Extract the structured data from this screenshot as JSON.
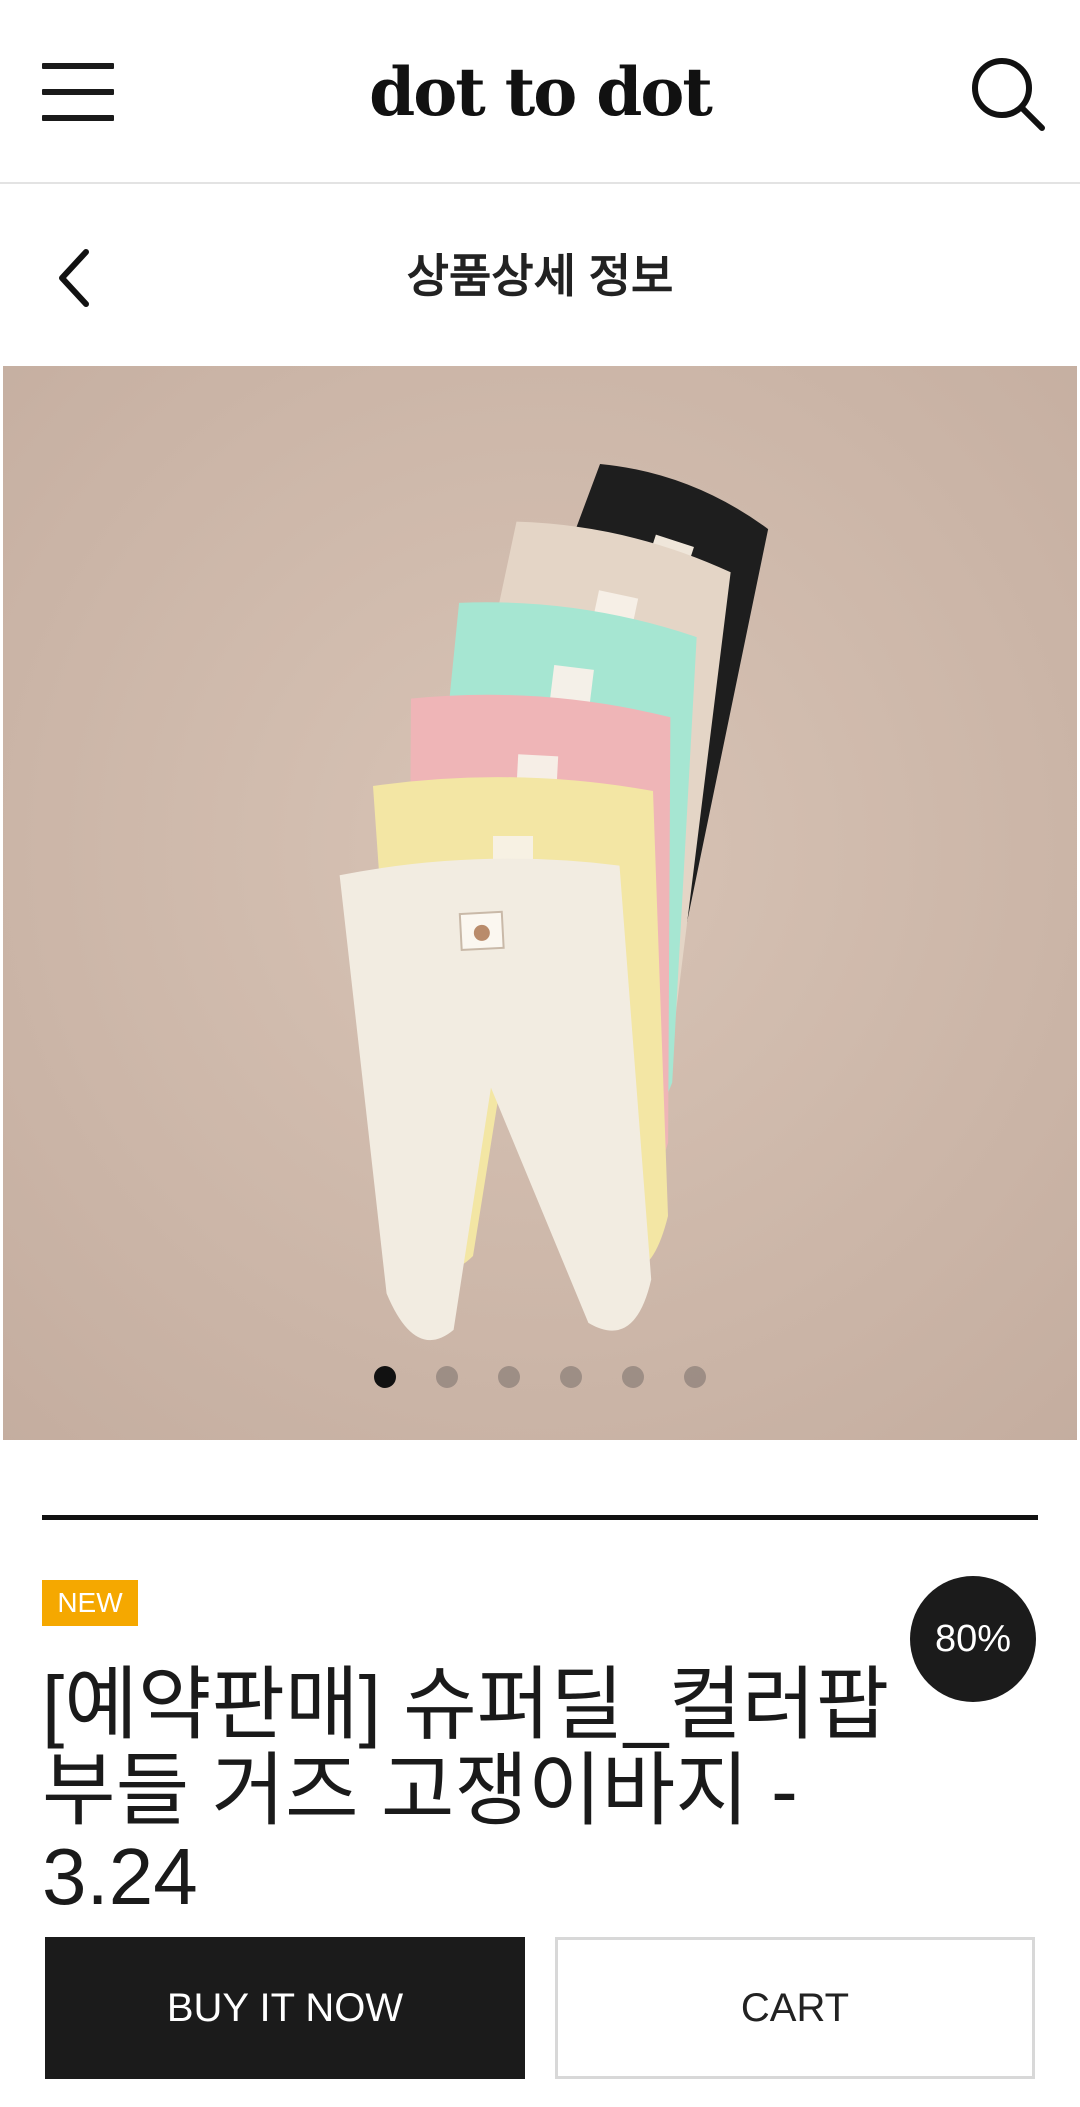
{
  "header": {
    "brand": "dot to dot",
    "menu_icon": "hamburger-menu-icon",
    "search_icon": "search-icon"
  },
  "subheader": {
    "back_icon": "chevron-left-icon",
    "title": "상품상세 정보"
  },
  "carousel": {
    "slide_count": 6,
    "active_index": 0,
    "image_description_icon": "product-photo"
  },
  "product": {
    "badge_new": "NEW",
    "discount": "80%",
    "name_line1": "[예약판매] 슈퍼딜_컬러팝",
    "name_line2": "부들 거즈 고쟁이바지 -",
    "name_line3": "3.24"
  },
  "actions": {
    "buy_now": "BUY IT NOW",
    "cart": "CART"
  },
  "colors": {
    "badge_new": "#f5a800",
    "primary_dark": "#1b1b1b",
    "photo_background": "#cdb8aa"
  }
}
